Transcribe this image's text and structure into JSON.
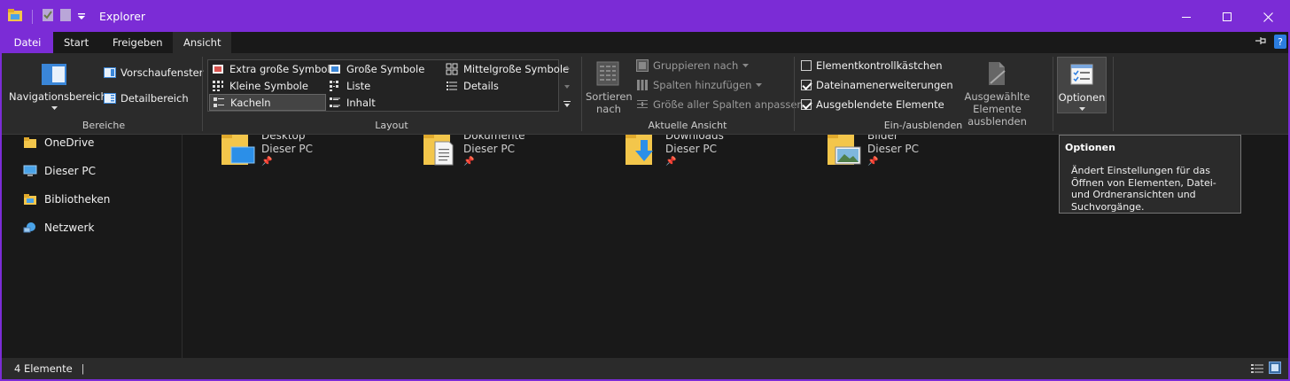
{
  "window": {
    "title": "Explorer",
    "accent_color": "#7b2cd6",
    "controls": [
      "minimize",
      "maximize",
      "close"
    ]
  },
  "quick_access_toolbar": [
    "folder-icon",
    "properties-icon",
    "new-folder-icon",
    "customize-dropdown-icon"
  ],
  "ribbon_tabs": {
    "file": "Datei",
    "start": "Start",
    "share": "Freigeben",
    "view": "Ansicht",
    "active": "Ansicht"
  },
  "ribbon": {
    "panes": {
      "navigation_pane": "Navigationsbereich",
      "preview_pane": "Vorschaufenster",
      "details_pane": "Detailbereich",
      "group_label": "Bereiche"
    },
    "layout": {
      "items": [
        "Extra große Symbole",
        "Große Symbole",
        "Mittelgroße Symbole",
        "Kleine Symbole",
        "Liste",
        "Details",
        "Kacheln",
        "Inhalt"
      ],
      "selected": "Kacheln",
      "group_label": "Layout"
    },
    "current_view": {
      "sort_line1": "Sortieren",
      "sort_line2": "nach",
      "group_by": "Gruppieren nach",
      "add_columns": "Spalten hinzufügen",
      "size_columns": "Größe aller Spalten anpassen",
      "group_label": "Aktuelle Ansicht"
    },
    "show_hide": {
      "item_checkboxes": {
        "label": "Elementkontrollkästchen",
        "checked": false
      },
      "file_extensions": {
        "label": "Dateinamenerweiterungen",
        "checked": true
      },
      "hidden_items": {
        "label": "Ausgeblendete Elemente",
        "checked": true
      },
      "hide_selected_line1": "Ausgewählte",
      "hide_selected_line2": "Elemente ausblenden",
      "group_label": "Ein-/ausblenden"
    },
    "options": {
      "label": "Optionen"
    }
  },
  "navigation": [
    {
      "label": "OneDrive",
      "icon": "onedrive-folder-icon"
    },
    {
      "label": "Dieser PC",
      "icon": "computer-icon"
    },
    {
      "label": "Bibliotheken",
      "icon": "libraries-icon"
    },
    {
      "label": "Netzwerk",
      "icon": "network-icon"
    }
  ],
  "content": {
    "tiles": [
      {
        "name": "Desktop",
        "location": "Dieser PC",
        "icon": "desktop-folder-icon"
      },
      {
        "name": "Dokumente",
        "location": "Dieser PC",
        "icon": "documents-folder-icon"
      },
      {
        "name": "Downloads",
        "location": "Dieser PC",
        "icon": "downloads-folder-icon"
      },
      {
        "name": "Bilder",
        "location": "Dieser PC",
        "icon": "pictures-folder-icon"
      }
    ]
  },
  "tooltip": {
    "title": "Optionen",
    "body": "Ändert Einstellungen für das Öffnen von Elementen, Datei- und Ordneransichten und Suchvorgänge."
  },
  "status": {
    "count": "4 Elemente"
  }
}
